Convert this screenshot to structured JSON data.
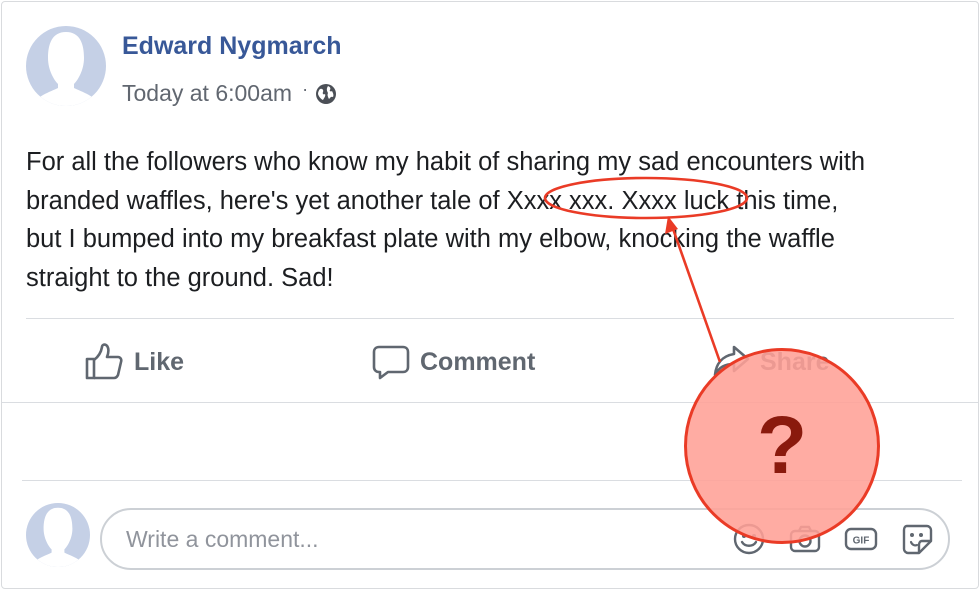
{
  "post": {
    "author": "Edward Nygmarch",
    "timestamp": "Today at 6:00am",
    "meta_separator": "·",
    "privacy_icon": "globe-icon",
    "lines": [
      "For all the followers who know my habit of sharing my sad encounters with",
      "branded waffles, here's yet another tale of ",
      "Xxxx xxx. Xxxx",
      " luck this time,",
      "but I bumped into my breakfast plate with my elbow, knocking the waffle",
      "straight to the ground. Sad!"
    ]
  },
  "actions": {
    "like_label": "Like",
    "comment_label": "Comment",
    "share_label": "Share"
  },
  "comment_box": {
    "placeholder": "Write a comment...",
    "tools": [
      "emoji-icon",
      "camera-icon",
      "gif-icon",
      "sticker-icon"
    ],
    "gif_text": "GIF"
  },
  "annotation": {
    "marker_text": "?",
    "accent_color": "#ea3b26",
    "fill_color": "#ffa096"
  },
  "colors": {
    "author": "#385898",
    "meta": "#616770",
    "action": "#606770",
    "avatar": "#c5d0e6"
  }
}
